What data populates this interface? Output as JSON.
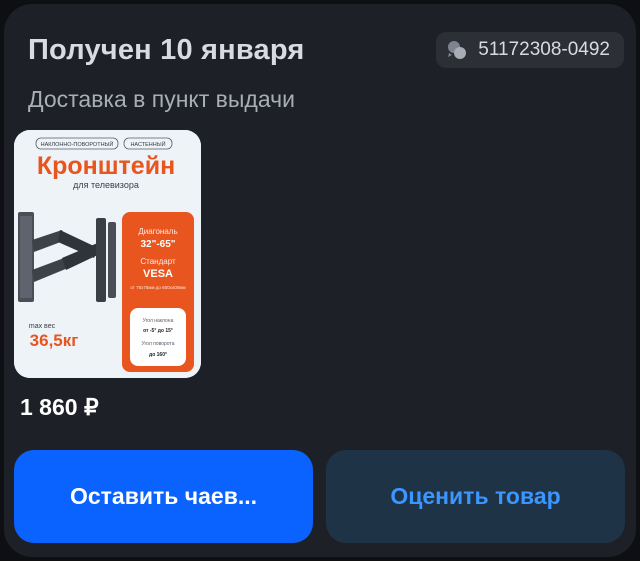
{
  "order": {
    "status_title": "Получен 10 января",
    "delivery_type": "Доставка в пункт выдачи",
    "order_number": "51172308-0492"
  },
  "product": {
    "image_tags": [
      "НАКЛОННО-ПОВОРОТНЫЙ",
      "НАСТЕННЫЙ"
    ],
    "image_title": "Кронштейн",
    "image_subtitle": "для телевизора",
    "image_max_label": "max вес",
    "image_max_value": "36,5кг",
    "image_diag_label": "Диагональ",
    "image_diag_value": "32\"-65\"",
    "image_std_label": "Стандарт",
    "image_std_value": "VESA",
    "image_std_range": "от 75х75мм до 600х400мм",
    "image_tilt_label": "Угол наклона",
    "image_tilt_value": "от -5° до 15°",
    "image_rot_label": "Угол поворота",
    "image_rot_value": "до 160°",
    "price": "1 860 ₽"
  },
  "actions": {
    "tip_label": "Оставить чаев...",
    "rate_label": "Оценить товар"
  },
  "colors": {
    "primary": "#0a63ff",
    "secondary_bg": "#1f3346",
    "secondary_text": "#3b96ff",
    "accent_orange": "#e8551f"
  },
  "icons": {
    "order_chip": "chat-bubbles-icon"
  }
}
